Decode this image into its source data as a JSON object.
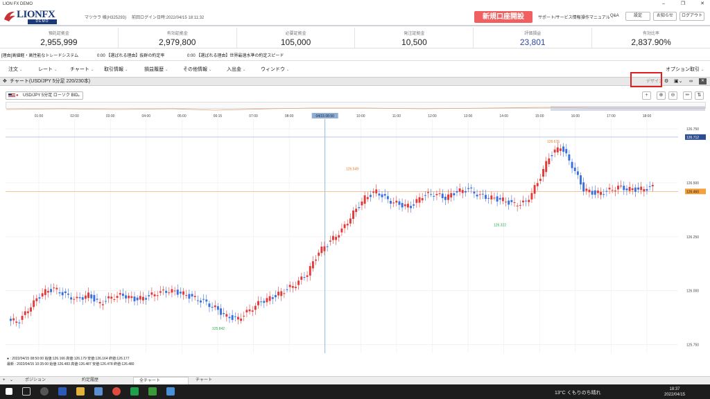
{
  "window": {
    "title": "LION FX DEMO"
  },
  "header": {
    "logo_text": "LIONFX",
    "logo_sub": "DEMO",
    "user": "マツウラ 様(H325293)",
    "last_login": "前回ログイン日時:2022/04/15 18:11:32",
    "open_account": "新規口座開設",
    "links": [
      "サポート/サービス情報",
      "操作マニュアル",
      "Q&A"
    ],
    "buttons": [
      "設定",
      "お知らせ",
      "ログアウト"
    ]
  },
  "summary": [
    {
      "label": "預託証拠金",
      "value": "2,955,999"
    },
    {
      "label": "有効証拠金",
      "value": "2,979,800"
    },
    {
      "label": "必要証拠金",
      "value": "105,000"
    },
    {
      "label": "発注証拠金",
      "value": "10,500"
    },
    {
      "label": "評価損益",
      "value": "23,801"
    },
    {
      "label": "有効比率",
      "value": "2,837.90%"
    }
  ],
  "ticker": [
    "[理由]高値軽・高性能なトレードシステム",
    "0:00 【選ばれる理由】抜群の約定率",
    "0:00 【選ばれる理由】世界最速水準の約定スピード"
  ],
  "menu": [
    "注文",
    "レート",
    "チャート",
    "取引情報",
    "損益履歴",
    "その他情報",
    "入出金",
    "ウィンドウ"
  ],
  "menu_right": "オプション取引",
  "chart_panel": {
    "title": "チャート(USD/JPY 5分足 220/230本)",
    "design_label": "デザイン",
    "symbol": "USD/JPY 5分足 ローソク BID"
  },
  "chart_data": {
    "type": "candlestick",
    "symbol": "USD/JPY",
    "x_ticks": [
      "01:00",
      "02:00",
      "03:00",
      "04:00",
      "05:00",
      "06:15",
      "07:00",
      "08:00",
      "04/15 08:50",
      "10:00",
      "11:00",
      "12:00",
      "13:00",
      "14:00",
      "15:00",
      "16:00",
      "17:00",
      "18:00"
    ],
    "y_ticks": [
      "126.750",
      "126.500",
      "126.250",
      "126.000",
      "125.750"
    ],
    "ylim": [
      125.71,
      126.795
    ],
    "candles": [
      125.86,
      125.93,
      125.99,
      126.01,
      125.98,
      125.96,
      125.98,
      125.94,
      125.97,
      125.98,
      125.96,
      125.97,
      125.99,
      126.0,
      125.99,
      125.97,
      125.95,
      125.92,
      125.88,
      125.87,
      125.91,
      125.95,
      125.97,
      126.0,
      126.03,
      126.08,
      126.18,
      126.23,
      126.28,
      126.36,
      126.43,
      126.46,
      126.42,
      126.4,
      126.39,
      126.44,
      126.45,
      126.43,
      126.46,
      126.47,
      126.44,
      126.43,
      126.42,
      126.4,
      126.41,
      126.5,
      126.62,
      126.67,
      126.58,
      126.47,
      126.45,
      126.46,
      126.48,
      126.47,
      126.47,
      126.48
    ],
    "annotations": [
      {
        "text": "126.549",
        "kind": "high"
      },
      {
        "text": "126.676",
        "kind": "high"
      },
      {
        "text": "126.322",
        "kind": "low"
      },
      {
        "text": "125.842",
        "kind": "low"
      }
    ],
    "price_labels": {
      "bid_line": "126.712",
      "current": "126.460"
    },
    "info_lines": [
      "● : 2022/04/15 08:50:00 始値:126.166 高値:126.179 安値:126.164 終値:126.177",
      "最新 : 2022/04/15 10:35:00 始値:126.483 高値:126.487 安値:126.478 終値:126.480"
    ]
  },
  "bottom_tabs": [
    "ポジション",
    "約定履歴",
    "全チャート",
    "チャート"
  ],
  "taskbar": {
    "weather": "13°C くもりのち晴れ",
    "time": "18:37",
    "date": "2022/04/15"
  }
}
